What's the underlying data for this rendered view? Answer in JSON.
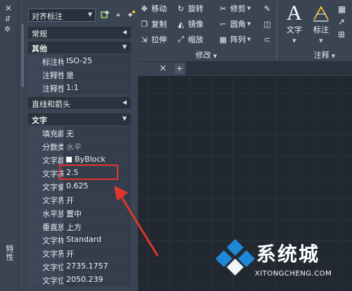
{
  "ribbon": {
    "modify_tools": [
      {
        "icon": "move-icon",
        "glyph": "✥",
        "label": "移动"
      },
      {
        "icon": "rotate-icon",
        "glyph": "↻",
        "label": "旋转"
      },
      {
        "icon": "trim-icon",
        "glyph": "✂",
        "label": "修剪",
        "dropdown": true
      },
      {
        "icon": "erase-icon",
        "glyph": "✎",
        "label": ""
      },
      {
        "icon": "copy-icon",
        "glyph": "❐",
        "label": "复制"
      },
      {
        "icon": "mirror-icon",
        "glyph": "◭",
        "label": "镜像"
      },
      {
        "icon": "fillet-icon",
        "glyph": "⌐",
        "label": "圆角",
        "dropdown": true
      },
      {
        "icon": "explode-icon",
        "glyph": "◫",
        "label": ""
      },
      {
        "icon": "stretch-icon",
        "glyph": "⇲",
        "label": "拉伸"
      },
      {
        "icon": "scale-icon",
        "glyph": "⤢",
        "label": "缩放"
      },
      {
        "icon": "array-icon",
        "glyph": "▦",
        "label": "阵列",
        "dropdown": true
      },
      {
        "icon": "offset-icon",
        "glyph": "⊂",
        "label": ""
      }
    ],
    "modify_panel_label": "修改",
    "text_button_label": "文字",
    "dimension_button_label": "标注",
    "annotation_panel_label": "注释"
  },
  "tab": {
    "close": "×",
    "add": "+"
  },
  "sidebar": {
    "close": "✕",
    "title": "特性"
  },
  "properties": {
    "selector_value": "对齐标注",
    "sections": {
      "general": "常规",
      "misc": "其他",
      "lines_arrows": "直线和箭头",
      "text": "文字"
    },
    "misc_rows": [
      {
        "key": "标注样式",
        "value": "ISO-25"
      },
      {
        "key": "注释性",
        "value": "是"
      },
      {
        "key": "注释性...",
        "value": "1:1"
      }
    ],
    "text_rows": [
      {
        "key": "填充颜色",
        "value": "无"
      },
      {
        "key": "分数类型",
        "value": "水平"
      },
      {
        "key": "文字颜色",
        "value": "ByBlock"
      },
      {
        "key": "文字高度",
        "value": "2.5"
      },
      {
        "key": "文字偏移",
        "value": "0.625"
      },
      {
        "key": "文字界...",
        "value": "开"
      },
      {
        "key": "水平放...",
        "value": "置中"
      },
      {
        "key": "垂直放...",
        "value": "上方"
      },
      {
        "key": "文字样式",
        "value": "Standard"
      },
      {
        "key": "文字界...",
        "value": "开"
      },
      {
        "key": "文字位...",
        "value": "2735.1757"
      },
      {
        "key": "文字位...",
        "value": "2050.239"
      }
    ]
  },
  "watermark": {
    "text": "系统城",
    "url": "XITONGCHENG.COM"
  },
  "colors": {
    "panel": "#3b4453",
    "canvas": "#212830",
    "highlight": "#e1352b",
    "watermark_blue": "#1e88d8"
  }
}
